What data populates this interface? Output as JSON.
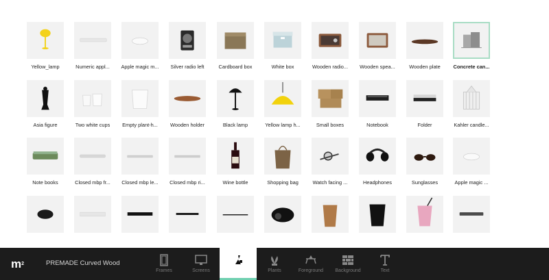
{
  "app": {
    "logo": "m",
    "project_name": "PREMADE Curved Wood"
  },
  "colors": {
    "accent": "#6fd0b0",
    "bar": "#1c1c1c",
    "selected_border": "#a8dcc4"
  },
  "objects": [
    [
      {
        "label": "Yellow_lamp",
        "icon": "yellow-lamp"
      },
      {
        "label": "Numeric appl...",
        "icon": "numeric-keypad"
      },
      {
        "label": "Apple magic m...",
        "icon": "magic-mouse"
      },
      {
        "label": "Silver radio left",
        "icon": "silver-radio"
      },
      {
        "label": "Cardboard box",
        "icon": "cardboard-box"
      },
      {
        "label": "White box",
        "icon": "white-box"
      },
      {
        "label": "Wooden radio...",
        "icon": "wooden-radio"
      },
      {
        "label": "Wooden spea...",
        "icon": "wooden-speaker"
      },
      {
        "label": "Wooden plate",
        "icon": "wooden-plate"
      },
      {
        "label": "Concrete can...",
        "icon": "concrete-cans",
        "selected": true
      }
    ],
    [
      {
        "label": "Asia figure",
        "icon": "asia-figure"
      },
      {
        "label": "Two white cups",
        "icon": "white-cups"
      },
      {
        "label": "Empty plant-h...",
        "icon": "plant-holder"
      },
      {
        "label": "Wooden holder",
        "icon": "wooden-holder"
      },
      {
        "label": "Black lamp",
        "icon": "black-lamp"
      },
      {
        "label": "Yellow lamp h...",
        "icon": "yellow-lamp-hanging"
      },
      {
        "label": "Small boxes",
        "icon": "small-boxes"
      },
      {
        "label": "Notebook",
        "icon": "notebook"
      },
      {
        "label": "Folder",
        "icon": "folder"
      },
      {
        "label": "Kahler candle...",
        "icon": "candle-holder"
      }
    ],
    [
      {
        "label": "Note books",
        "icon": "note-books"
      },
      {
        "label": "Closed mbp fr...",
        "icon": "closed-laptop"
      },
      {
        "label": "Closed mbp le...",
        "icon": "closed-laptop-left"
      },
      {
        "label": "Closed mbp ri...",
        "icon": "closed-laptop-right"
      },
      {
        "label": "Wine bottle",
        "icon": "wine-bottle"
      },
      {
        "label": "Shopping bag",
        "icon": "shopping-bag"
      },
      {
        "label": "Watch facing ...",
        "icon": "watch"
      },
      {
        "label": "Headphones",
        "icon": "headphones"
      },
      {
        "label": "Sunglasses",
        "icon": "sunglasses"
      },
      {
        "label": "Apple magic ...",
        "icon": "magic-mouse"
      }
    ],
    [
      {
        "label": "",
        "icon": "black-mouse"
      },
      {
        "label": "",
        "icon": "keyboard"
      },
      {
        "label": "",
        "icon": "black-slab"
      },
      {
        "label": "",
        "icon": "black-board"
      },
      {
        "label": "",
        "icon": "thin-plate"
      },
      {
        "label": "",
        "icon": "camera-bag"
      },
      {
        "label": "",
        "icon": "coffee-cup"
      },
      {
        "label": "",
        "icon": "black-cup"
      },
      {
        "label": "",
        "icon": "pink-cup"
      },
      {
        "label": "",
        "icon": "tablet"
      }
    ]
  ],
  "categories": [
    {
      "label": "Frames",
      "icon": "frame-icon",
      "active": false
    },
    {
      "label": "Screens",
      "icon": "monitor-icon",
      "active": false
    },
    {
      "label": "",
      "icon": "shapes-icon",
      "active": true
    },
    {
      "label": "Plants",
      "icon": "plant-icon",
      "active": false
    },
    {
      "label": "Foreground",
      "icon": "foreground-icon",
      "active": false
    },
    {
      "label": "Background",
      "icon": "brick-wall-icon",
      "active": false
    },
    {
      "label": "Text",
      "icon": "text-icon",
      "active": false
    }
  ]
}
